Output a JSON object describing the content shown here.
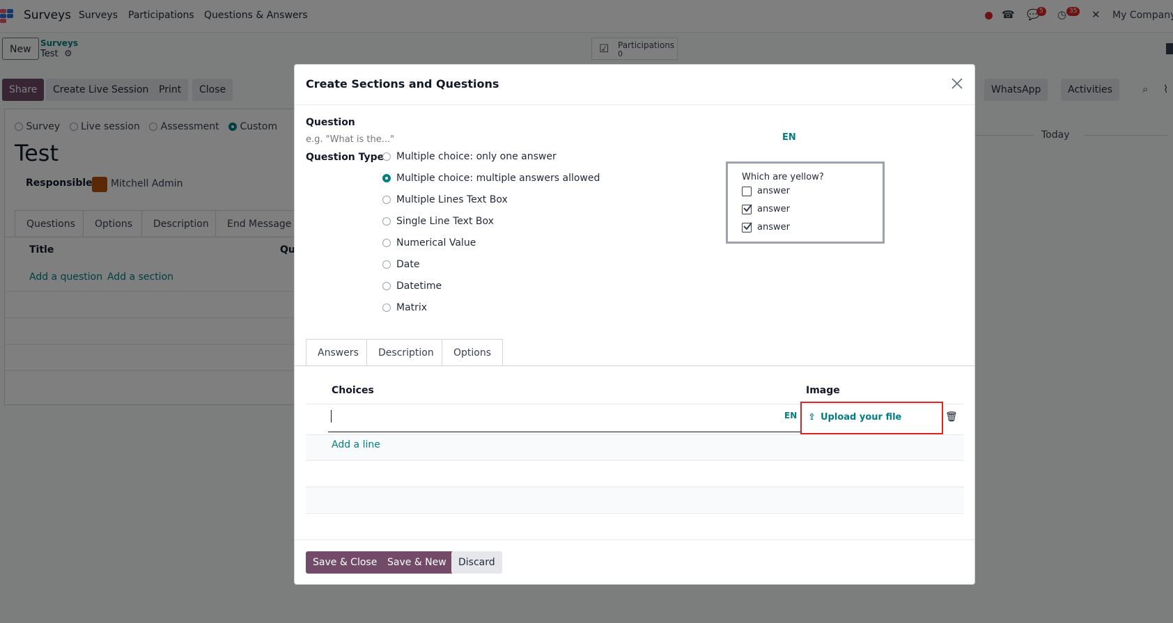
{
  "nav": {
    "app_name": "Surveys",
    "menu": [
      "Surveys",
      "Participations",
      "Questions & Answers"
    ],
    "messages_count": "5",
    "activities_count": "35",
    "company": "My Company"
  },
  "control": {
    "new_label": "New",
    "breadcrumb_parent": "Surveys",
    "breadcrumb_current": "Test",
    "smart_button_label": "Participations",
    "smart_button_value": "0",
    "buttons": [
      "Share",
      "Create Live Session",
      "Print",
      "Close"
    ],
    "chatter_buttons": [
      "WhatsApp",
      "Activities"
    ],
    "today_label": "Today"
  },
  "form": {
    "survey_types": [
      "Survey",
      "Live session",
      "Assessment",
      "Custom"
    ],
    "title": "Test",
    "responsible_label": "Responsible",
    "responsible_value": "Mitchell Admin",
    "tabs": [
      "Questions",
      "Options",
      "Description",
      "End Message"
    ],
    "col_title": "Title",
    "col_q": "Qu",
    "add_question": "Add a question",
    "add_section": "Add a section"
  },
  "modal": {
    "title": "Create Sections and Questions",
    "question_label": "Question",
    "question_placeholder": "e.g. \"What is the...\"",
    "lang": "EN",
    "question_type_label": "Question Type",
    "question_types": [
      "Multiple choice: only one answer",
      "Multiple choice: multiple answers allowed",
      "Multiple Lines Text Box",
      "Single Line Text Box",
      "Numerical Value",
      "Date",
      "Datetime",
      "Matrix"
    ],
    "selected_type": "Multiple choice: multiple answers allowed",
    "preview": {
      "question": "Which are yellow?",
      "answers": [
        "answer",
        "answer",
        "answer"
      ]
    },
    "tabs": [
      "Answers",
      "Description",
      "Options"
    ],
    "choices_header": "Choices",
    "image_header": "Image",
    "choice_lang": "EN",
    "upload_label": "Upload your file",
    "add_line": "Add a line",
    "footer_buttons": [
      "Save & Close",
      "Save & New",
      "Discard"
    ]
  },
  "colors": {
    "primary": "#714b67",
    "link": "#017e84",
    "highlight": "#dc2626"
  }
}
